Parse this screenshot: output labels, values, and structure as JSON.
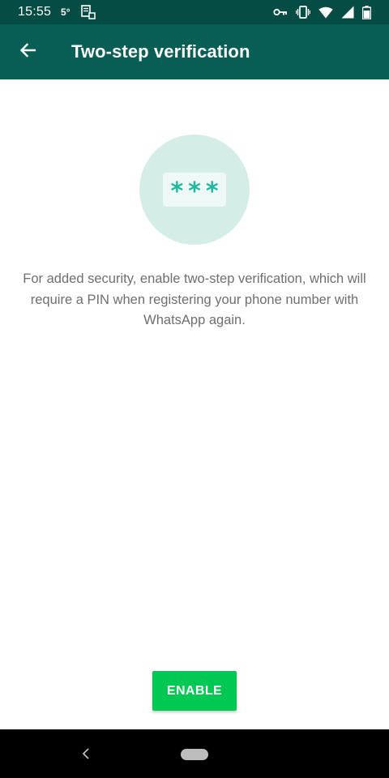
{
  "status_bar": {
    "time": "15:55",
    "temperature": "5°",
    "icons": [
      "sim-storage-icon",
      "key-icon",
      "vibrate-icon",
      "wifi-icon",
      "signal-icon",
      "battery-icon"
    ]
  },
  "app_bar": {
    "title": "Two-step verification",
    "background": "#075e54"
  },
  "main": {
    "pin_placeholder": "***",
    "description": "For added security, enable two-step verification, which will require a PIN when registering your phone number with WhatsApp again.",
    "enable_label": "ENABLE",
    "accent": "#00c853"
  },
  "nav_bar": {
    "icons": [
      "nav-back-icon",
      "nav-home-pill"
    ]
  }
}
